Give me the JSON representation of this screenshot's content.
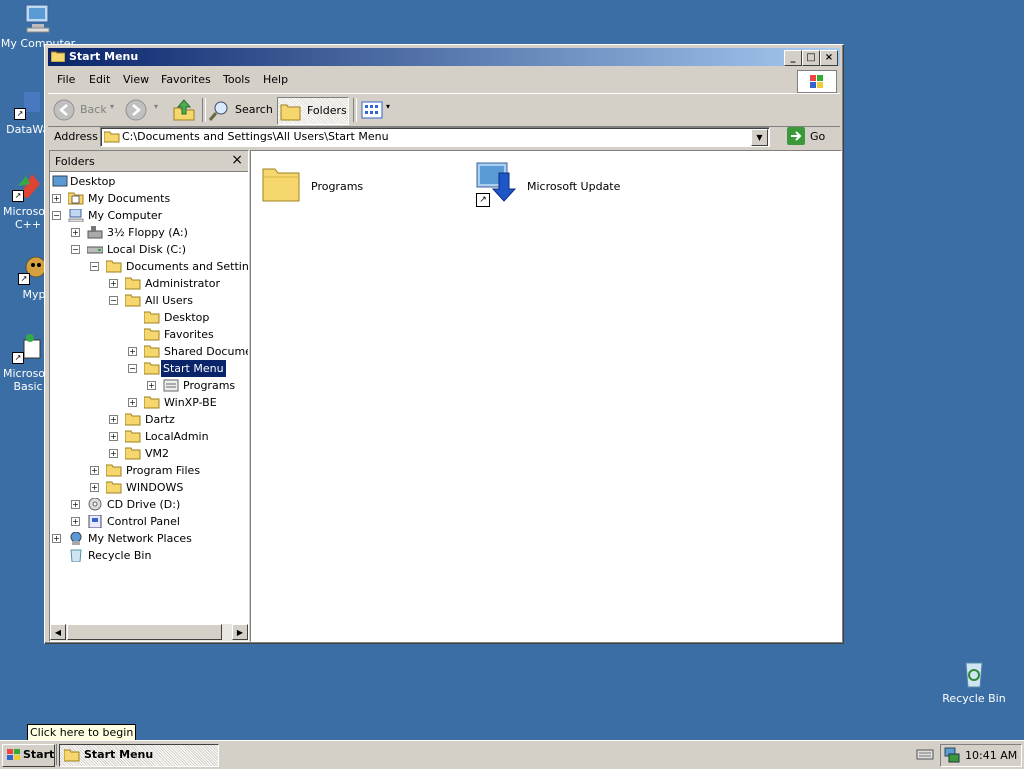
{
  "desktop": {
    "icons": [
      {
        "label": "My Computer"
      },
      {
        "label": "DataWar"
      },
      {
        "label": "Microsoft C++"
      },
      {
        "label": "Myp"
      },
      {
        "label": "Microsoft Basic"
      },
      {
        "label": "Recycle Bin"
      }
    ]
  },
  "window": {
    "title": "Start Menu",
    "controls": {
      "minimize": "_",
      "maximize": "□",
      "close": "×"
    },
    "menu": [
      "File",
      "Edit",
      "View",
      "Favorites",
      "Tools",
      "Help"
    ],
    "toolbar": {
      "back": "Back",
      "search": "Search",
      "folders": "Folders"
    },
    "address": {
      "label": "Address",
      "value": "C:\\Documents and Settings\\All Users\\Start Menu",
      "go": "Go"
    },
    "folders_pane": {
      "title": "Folders",
      "close": "×",
      "tree": [
        {
          "label": "Desktop"
        },
        {
          "label": "My Documents"
        },
        {
          "label": "My Computer"
        },
        {
          "label": "3½ Floppy (A:)"
        },
        {
          "label": "Local Disk (C:)"
        },
        {
          "label": "Documents and Settings"
        },
        {
          "label": "Administrator"
        },
        {
          "label": "All Users"
        },
        {
          "label": "Desktop"
        },
        {
          "label": "Favorites"
        },
        {
          "label": "Shared Documents"
        },
        {
          "label": "Start Menu"
        },
        {
          "label": "Programs"
        },
        {
          "label": "WinXP-BE"
        },
        {
          "label": "Dartz"
        },
        {
          "label": "LocalAdmin"
        },
        {
          "label": "VM2"
        },
        {
          "label": "Program Files"
        },
        {
          "label": "WINDOWS"
        },
        {
          "label": "CD Drive (D:)"
        },
        {
          "label": "Control Panel"
        },
        {
          "label": "My Network Places"
        },
        {
          "label": "Recycle Bin"
        }
      ]
    },
    "content": [
      {
        "label": "Programs"
      },
      {
        "label": "Microsoft Update"
      }
    ]
  },
  "taskbar": {
    "start": "Start",
    "tooltip": "Click here to begin",
    "task": "Start Menu",
    "clock": "10:41 AM"
  }
}
